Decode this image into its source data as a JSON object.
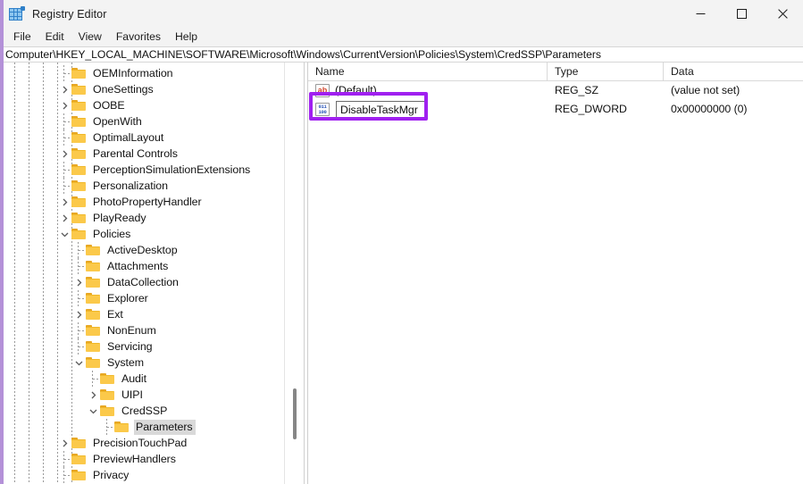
{
  "window": {
    "title": "Registry Editor",
    "icon": "registry-editor-icon",
    "controls": {
      "minimize": "minimize-icon",
      "maximize": "maximize-icon",
      "close": "close-icon"
    }
  },
  "menubar": {
    "items": [
      {
        "label": "File"
      },
      {
        "label": "Edit"
      },
      {
        "label": "View"
      },
      {
        "label": "Favorites"
      },
      {
        "label": "Help"
      }
    ]
  },
  "address": {
    "path": "Computer\\HKEY_LOCAL_MACHINE\\SOFTWARE\\Microsoft\\Windows\\CurrentVersion\\Policies\\System\\CredSSP\\Parameters"
  },
  "tree": {
    "nodes": [
      {
        "label": "OEMInformation",
        "indent": 5,
        "expander": "none",
        "selected": false
      },
      {
        "label": "OneSettings",
        "indent": 5,
        "expander": "collapsed",
        "selected": false
      },
      {
        "label": "OOBE",
        "indent": 5,
        "expander": "collapsed",
        "selected": false
      },
      {
        "label": "OpenWith",
        "indent": 5,
        "expander": "none",
        "selected": false
      },
      {
        "label": "OptimalLayout",
        "indent": 5,
        "expander": "none",
        "selected": false
      },
      {
        "label": "Parental Controls",
        "indent": 5,
        "expander": "collapsed",
        "selected": false
      },
      {
        "label": "PerceptionSimulationExtensions",
        "indent": 5,
        "expander": "none",
        "selected": false
      },
      {
        "label": "Personalization",
        "indent": 5,
        "expander": "none",
        "selected": false
      },
      {
        "label": "PhotoPropertyHandler",
        "indent": 5,
        "expander": "collapsed",
        "selected": false
      },
      {
        "label": "PlayReady",
        "indent": 5,
        "expander": "collapsed",
        "selected": false
      },
      {
        "label": "Policies",
        "indent": 5,
        "expander": "expanded",
        "selected": false
      },
      {
        "label": "ActiveDesktop",
        "indent": 6,
        "expander": "none",
        "selected": false
      },
      {
        "label": "Attachments",
        "indent": 6,
        "expander": "none",
        "selected": false
      },
      {
        "label": "DataCollection",
        "indent": 6,
        "expander": "collapsed",
        "selected": false
      },
      {
        "label": "Explorer",
        "indent": 6,
        "expander": "none",
        "selected": false
      },
      {
        "label": "Ext",
        "indent": 6,
        "expander": "collapsed",
        "selected": false
      },
      {
        "label": "NonEnum",
        "indent": 6,
        "expander": "none",
        "selected": false
      },
      {
        "label": "Servicing",
        "indent": 6,
        "expander": "none",
        "selected": false
      },
      {
        "label": "System",
        "indent": 6,
        "expander": "expanded",
        "selected": false
      },
      {
        "label": "Audit",
        "indent": 7,
        "expander": "none",
        "selected": false
      },
      {
        "label": "UIPI",
        "indent": 7,
        "expander": "collapsed",
        "selected": false
      },
      {
        "label": "CredSSP",
        "indent": 7,
        "expander": "expanded",
        "selected": false
      },
      {
        "label": "Parameters",
        "indent": 8,
        "expander": "none",
        "selected": true
      },
      {
        "label": "PrecisionTouchPad",
        "indent": 5,
        "expander": "collapsed",
        "selected": false
      },
      {
        "label": "PreviewHandlers",
        "indent": 5,
        "expander": "none",
        "selected": false
      },
      {
        "label": "Privacy",
        "indent": 5,
        "expander": "none",
        "selected": false
      }
    ]
  },
  "values": {
    "columns": [
      {
        "label": "Name"
      },
      {
        "label": "Type"
      },
      {
        "label": "Data"
      }
    ],
    "rows": [
      {
        "name": "(Default)",
        "icon": "reg-sz-icon",
        "icon_glyph": "ab",
        "type": "REG_SZ",
        "data": "(value not set)",
        "editing": false
      },
      {
        "name": "DisableTaskMgr",
        "icon": "reg-dword-icon",
        "icon_glyph_top": "011",
        "icon_glyph_bottom": "100",
        "type": "REG_DWORD",
        "data": "0x00000000 (0)",
        "editing": true
      }
    ]
  },
  "annotation": {
    "color": "#a020f0",
    "target": "rename-edit-box"
  }
}
